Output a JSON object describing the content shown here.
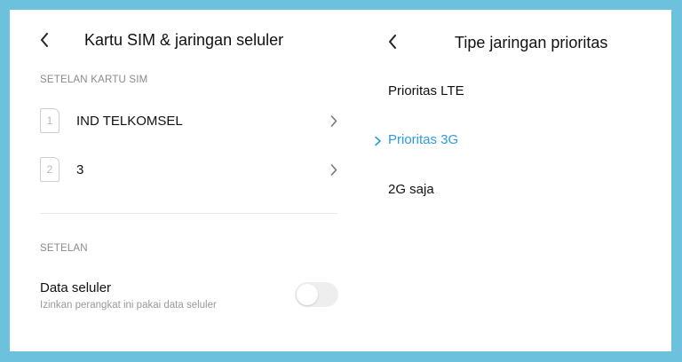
{
  "colors": {
    "border": "#6cc1dd",
    "accent": "#2a9be0",
    "text": "#111111",
    "muted": "#8a8a8a"
  },
  "left_panel": {
    "back_icon": "chevron-left-icon",
    "title": "Kartu SIM & jaringan seluler",
    "sim_section_label": "SETELAN KARTU SIM",
    "sims": [
      {
        "slot": "1",
        "name": "IND TELKOMSEL"
      },
      {
        "slot": "2",
        "name": "3"
      }
    ],
    "settings_section_label": "SETELAN",
    "mobile_data": {
      "title": "Data seluler",
      "subtitle": "Izinkan perangkat ini pakai data seluler",
      "enabled": false
    }
  },
  "right_panel": {
    "back_icon": "chevron-left-icon",
    "title": "Tipe jaringan prioritas",
    "options": [
      {
        "label": "Prioritas LTE",
        "selected": false
      },
      {
        "label": "Prioritas 3G",
        "selected": true
      },
      {
        "label": "2G saja",
        "selected": false
      }
    ]
  }
}
